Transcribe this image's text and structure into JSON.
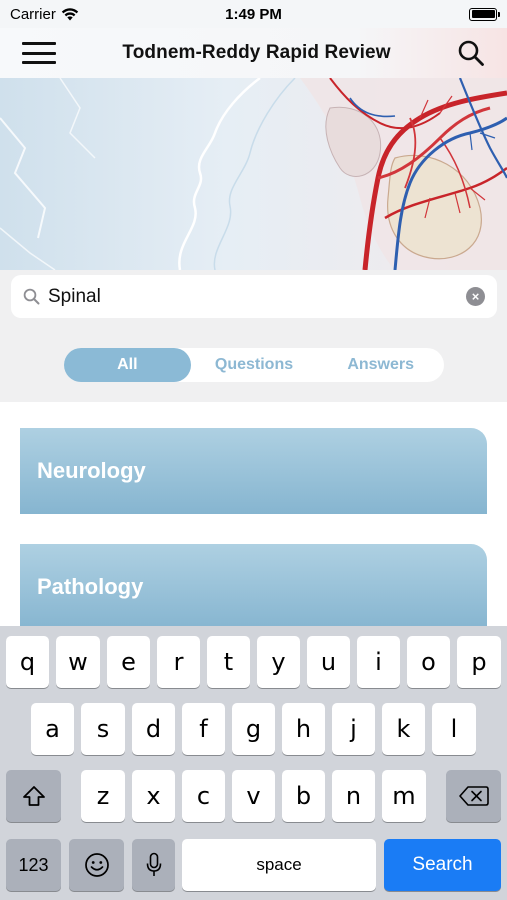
{
  "status_bar": {
    "carrier": "Carrier",
    "time": "1:49 PM"
  },
  "nav": {
    "title": "Todnem-Reddy Rapid Review"
  },
  "search": {
    "value": "Spinal"
  },
  "segments": [
    {
      "label": "All",
      "selected": true
    },
    {
      "label": "Questions",
      "selected": false
    },
    {
      "label": "Answers",
      "selected": false
    }
  ],
  "categories": [
    {
      "label": "Neurology"
    },
    {
      "label": "Pathology"
    }
  ],
  "keyboard": {
    "row1": [
      "q",
      "w",
      "e",
      "r",
      "t",
      "y",
      "u",
      "i",
      "o",
      "p"
    ],
    "row2": [
      "a",
      "s",
      "d",
      "f",
      "g",
      "h",
      "j",
      "k",
      "l"
    ],
    "row3": [
      "z",
      "x",
      "c",
      "v",
      "b",
      "n",
      "m"
    ],
    "numbers_label": "123",
    "space_label": "space",
    "action_label": "Search"
  },
  "colors": {
    "accent": "#8bbad6",
    "search_key": "#1a7cf5",
    "category_top": "#aed0e2",
    "category_bottom": "#86b5d0"
  }
}
